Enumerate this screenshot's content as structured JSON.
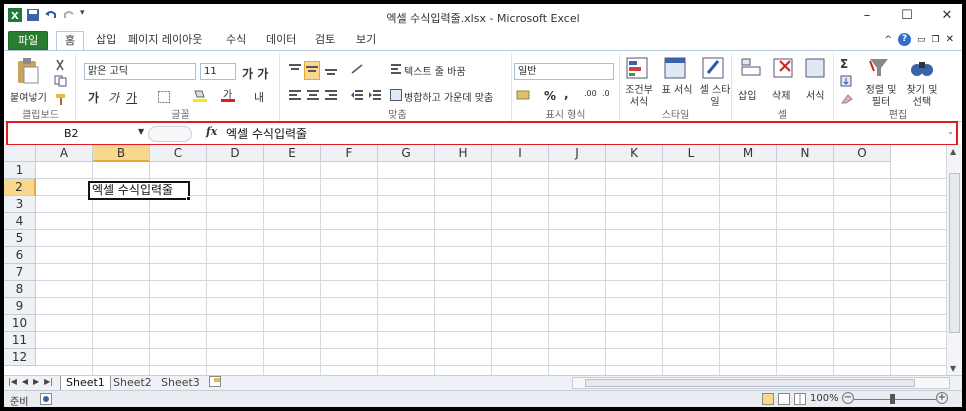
{
  "window": {
    "title": "엑셀 수식입력줄.xlsx - Microsoft Excel",
    "controls": [
      "–",
      "☐",
      "✕"
    ]
  },
  "ribbon_tabs": {
    "file": "파일",
    "items": [
      "홈",
      "삽입",
      "페이지 레이아웃",
      "수식",
      "데이터",
      "검토",
      "보기"
    ],
    "active": "홈"
  },
  "ribbon": {
    "clipboard": {
      "paste": "붙여넣기",
      "label": "클립보드"
    },
    "font": {
      "name": "맑은 고딕",
      "size": "11",
      "label": "글꼴"
    },
    "alignment": {
      "wrap": "텍스트 줄 바꿈",
      "merge": "병합하고 가운데 맞춤",
      "label": "맞춤"
    },
    "number": {
      "format": "일반",
      "label": "표시 형식"
    },
    "styles": {
      "cond": "조건부 서식",
      "table": "표 서식",
      "cell": "셀 스타일",
      "label": "스타일"
    },
    "cells": {
      "insert": "삽입",
      "delete": "삭제",
      "format": "서식",
      "label": "셀"
    },
    "editing": {
      "sort": "정렬 및 필터",
      "find": "찾기 및 선택",
      "label": "편집"
    }
  },
  "formula_bar": {
    "name_box": "B2",
    "fx": "fx",
    "content": "엑셀 수식입력줄",
    "highlight_color": "#e21b22"
  },
  "grid": {
    "columns": [
      "A",
      "B",
      "C",
      "D",
      "E",
      "F",
      "G",
      "H",
      "I",
      "J",
      "K",
      "L",
      "M",
      "N",
      "O"
    ],
    "rows": [
      "1",
      "2",
      "3",
      "4",
      "5",
      "6",
      "7",
      "8",
      "9",
      "10",
      "11",
      "12"
    ],
    "selected_column": "B",
    "selected_row": "2",
    "active_cell_value": "엑셀 수식입력줄"
  },
  "sheets": {
    "tabs": [
      "Sheet1",
      "Sheet2",
      "Sheet3"
    ],
    "active": "Sheet1"
  },
  "status": {
    "ready": "준비",
    "zoom": "100%"
  }
}
